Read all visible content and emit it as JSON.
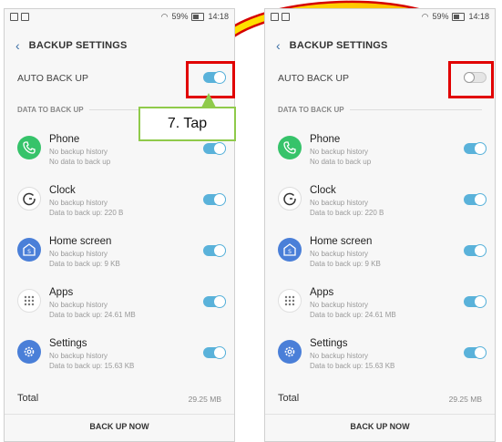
{
  "screens": [
    {
      "status": {
        "battery": "59%",
        "time": "14:18"
      },
      "title": "BACKUP SETTINGS",
      "auto_backup_label": "AUTO BACK UP",
      "auto_backup_on": true,
      "section_label": "DATA TO BACK UP",
      "items": [
        {
          "name": "Phone",
          "history": "No backup history",
          "data": "No data to back up",
          "icon": "phone-icon"
        },
        {
          "name": "Clock",
          "history": "No backup history",
          "data": "Data to back up: 220 B",
          "icon": "clock-icon"
        },
        {
          "name": "Home screen",
          "history": "No backup history",
          "data": "Data to back up: 9 KB",
          "icon": "home-screen-icon"
        },
        {
          "name": "Apps",
          "history": "No backup history",
          "data": "Data to back up: 24.61 MB",
          "icon": "apps-grid-icon"
        },
        {
          "name": "Settings",
          "history": "No backup history",
          "data": "Data to back up: 15.63 KB",
          "icon": "gear-icon"
        }
      ],
      "total_label": "Total",
      "total_value": "29.25 MB",
      "backup_button": "BACK UP NOW"
    },
    {
      "status": {
        "battery": "59%",
        "time": "14:18"
      },
      "title": "BACKUP SETTINGS",
      "auto_backup_label": "AUTO BACK UP",
      "auto_backup_on": false,
      "section_label": "DATA TO BACK UP",
      "items": [
        {
          "name": "Phone",
          "history": "No backup history",
          "data": "No data to back up",
          "icon": "phone-icon"
        },
        {
          "name": "Clock",
          "history": "No backup history",
          "data": "Data to back up: 220 B",
          "icon": "clock-icon"
        },
        {
          "name": "Home screen",
          "history": "No backup history",
          "data": "Data to back up: 9 KB",
          "icon": "home-screen-icon"
        },
        {
          "name": "Apps",
          "history": "No backup history",
          "data": "Data to back up: 24.61 MB",
          "icon": "apps-grid-icon"
        },
        {
          "name": "Settings",
          "history": "No backup history",
          "data": "Data to back up: 15.63 KB",
          "icon": "gear-icon"
        }
      ],
      "total_label": "Total",
      "total_value": "29.25 MB",
      "backup_button": "BACK UP NOW"
    }
  ],
  "callout_text": "7. Tap",
  "colors": {
    "accent": "#5ab2da",
    "highlight": "#e10000",
    "callout_border": "#8fca4a",
    "arrow": "#f5d000"
  }
}
